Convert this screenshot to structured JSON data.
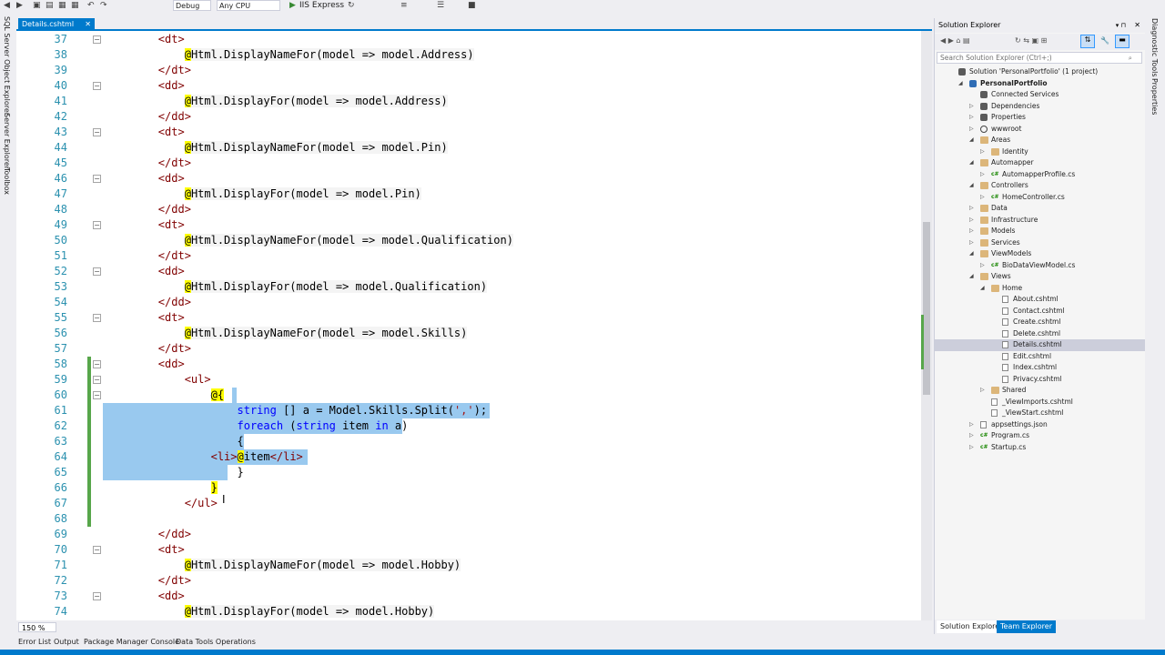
{
  "toolbar": {
    "config": "Debug",
    "platform": "Any CPU",
    "run_label": "IIS Express"
  },
  "left_tools": [
    "SQL Server Object Explorer",
    "Server Explorer",
    "Toolbox"
  ],
  "right_tools": [
    "Diagnostic Tools",
    "Properties"
  ],
  "tab": {
    "title": "Details.cshtml"
  },
  "editor": {
    "zoom": "150 %",
    "lines": [
      {
        "n": "37",
        "parts": [
          {
            "t": "        "
          },
          {
            "t": "<dt>",
            "c": "tag"
          }
        ]
      },
      {
        "n": "38",
        "parts": [
          {
            "t": "            "
          },
          {
            "t": "@",
            "c": "at"
          },
          {
            "t": "Html.DisplayNameFor(model => model.Address)",
            "c": "rz"
          }
        ]
      },
      {
        "n": "39",
        "parts": [
          {
            "t": "        "
          },
          {
            "t": "</dt>",
            "c": "tag"
          }
        ]
      },
      {
        "n": "40",
        "parts": [
          {
            "t": "        "
          },
          {
            "t": "<dd>",
            "c": "tag"
          }
        ]
      },
      {
        "n": "41",
        "parts": [
          {
            "t": "            "
          },
          {
            "t": "@",
            "c": "at"
          },
          {
            "t": "Html.DisplayFor(model => model.Address)",
            "c": "rz"
          }
        ]
      },
      {
        "n": "42",
        "parts": [
          {
            "t": "        "
          },
          {
            "t": "</dd>",
            "c": "tag"
          }
        ]
      },
      {
        "n": "43",
        "parts": [
          {
            "t": "        "
          },
          {
            "t": "<dt>",
            "c": "tag"
          }
        ]
      },
      {
        "n": "44",
        "parts": [
          {
            "t": "            "
          },
          {
            "t": "@",
            "c": "at"
          },
          {
            "t": "Html.DisplayNameFor(model => model.Pin)",
            "c": "rz"
          }
        ]
      },
      {
        "n": "45",
        "parts": [
          {
            "t": "        "
          },
          {
            "t": "</dt>",
            "c": "tag"
          }
        ]
      },
      {
        "n": "46",
        "parts": [
          {
            "t": "        "
          },
          {
            "t": "<dd>",
            "c": "tag"
          }
        ]
      },
      {
        "n": "47",
        "parts": [
          {
            "t": "            "
          },
          {
            "t": "@",
            "c": "at"
          },
          {
            "t": "Html.DisplayFor(model => model.Pin)",
            "c": "rz"
          }
        ]
      },
      {
        "n": "48",
        "parts": [
          {
            "t": "        "
          },
          {
            "t": "</dd>",
            "c": "tag"
          }
        ]
      },
      {
        "n": "49",
        "parts": [
          {
            "t": "        "
          },
          {
            "t": "<dt>",
            "c": "tag"
          }
        ]
      },
      {
        "n": "50",
        "parts": [
          {
            "t": "            "
          },
          {
            "t": "@",
            "c": "at"
          },
          {
            "t": "Html.DisplayNameFor(model => model.Qualification)",
            "c": "rz"
          }
        ]
      },
      {
        "n": "51",
        "parts": [
          {
            "t": "        "
          },
          {
            "t": "</dt>",
            "c": "tag"
          }
        ]
      },
      {
        "n": "52",
        "parts": [
          {
            "t": "        "
          },
          {
            "t": "<dd>",
            "c": "tag"
          }
        ]
      },
      {
        "n": "53",
        "parts": [
          {
            "t": "            "
          },
          {
            "t": "@",
            "c": "at"
          },
          {
            "t": "Html.DisplayFor(model => model.Qualification)",
            "c": "rz"
          }
        ]
      },
      {
        "n": "54",
        "parts": [
          {
            "t": "        "
          },
          {
            "t": "</dd>",
            "c": "tag"
          }
        ]
      },
      {
        "n": "55",
        "parts": [
          {
            "t": "        "
          },
          {
            "t": "<dt>",
            "c": "tag"
          }
        ]
      },
      {
        "n": "56",
        "parts": [
          {
            "t": "            "
          },
          {
            "t": "@",
            "c": "at"
          },
          {
            "t": "Html.DisplayNameFor(model => model.Skills)",
            "c": "rz"
          }
        ]
      },
      {
        "n": "57",
        "parts": [
          {
            "t": "        "
          },
          {
            "t": "</dt>",
            "c": "tag"
          }
        ]
      },
      {
        "n": "58",
        "parts": [
          {
            "t": "        "
          },
          {
            "t": "<dd>",
            "c": "tag"
          }
        ]
      },
      {
        "n": "59",
        "parts": [
          {
            "t": "            "
          },
          {
            "t": "<ul>",
            "c": "tag"
          }
        ]
      },
      {
        "n": "60",
        "parts": [
          {
            "t": "                "
          },
          {
            "t": "@{",
            "c": "at"
          }
        ]
      },
      {
        "n": "61",
        "parts": [
          {
            "t": "                    "
          },
          {
            "t": "string",
            "c": "blue"
          },
          {
            "t": " [] a = Model.Skills.Split("
          },
          {
            "t": "','",
            "c": "str"
          },
          {
            "t": ");"
          }
        ]
      },
      {
        "n": "62",
        "parts": [
          {
            "t": "                    "
          },
          {
            "t": "foreach",
            "c": "blue"
          },
          {
            "t": " ("
          },
          {
            "t": "string",
            "c": "blue"
          },
          {
            "t": " item "
          },
          {
            "t": "in",
            "c": "blue"
          },
          {
            "t": " a)"
          }
        ]
      },
      {
        "n": "63",
        "parts": [
          {
            "t": "                    {"
          }
        ]
      },
      {
        "n": "64",
        "parts": [
          {
            "t": "                "
          },
          {
            "t": "<li>",
            "c": "tag"
          },
          {
            "t": "@",
            "c": "at"
          },
          {
            "t": "item"
          },
          {
            "t": "</li>",
            "c": "tag"
          }
        ]
      },
      {
        "n": "65",
        "parts": [
          {
            "t": "                    }"
          }
        ]
      },
      {
        "n": "66",
        "parts": [
          {
            "t": "                "
          },
          {
            "t": "}",
            "c": "at"
          }
        ]
      },
      {
        "n": "67",
        "parts": [
          {
            "t": "            "
          },
          {
            "t": "</ul>",
            "c": "tag"
          }
        ]
      },
      {
        "n": "68",
        "parts": []
      },
      {
        "n": "69",
        "parts": [
          {
            "t": "        "
          },
          {
            "t": "</dd>",
            "c": "tag"
          }
        ]
      },
      {
        "n": "70",
        "parts": [
          {
            "t": "        "
          },
          {
            "t": "<dt>",
            "c": "tag"
          }
        ]
      },
      {
        "n": "71",
        "parts": [
          {
            "t": "            "
          },
          {
            "t": "@",
            "c": "at"
          },
          {
            "t": "Html.DisplayNameFor(model => model.Hobby)",
            "c": "rz"
          }
        ]
      },
      {
        "n": "72",
        "parts": [
          {
            "t": "        "
          },
          {
            "t": "</dt>",
            "c": "tag"
          }
        ]
      },
      {
        "n": "73",
        "parts": [
          {
            "t": "        "
          },
          {
            "t": "<dd>",
            "c": "tag"
          }
        ]
      },
      {
        "n": "74",
        "parts": [
          {
            "t": "            "
          },
          {
            "t": "@",
            "c": "at"
          },
          {
            "t": "Html.DisplayFor(model => model.Hobby)",
            "c": "rz"
          }
        ]
      }
    ]
  },
  "solution_explorer": {
    "title": "Solution Explorer",
    "search_placeholder": "Search Solution Explorer (Ctrl+;)",
    "items": [
      {
        "label": "Solution 'PersonalPortfolio' (1 project)",
        "depth": 0,
        "icon": "solution-icon",
        "arrow": ""
      },
      {
        "label": "PersonalPortfolio",
        "depth": 1,
        "icon": "web-project-icon",
        "arrow": "open",
        "bold": true
      },
      {
        "label": "Connected Services",
        "depth": 2,
        "icon": "connected-services-icon",
        "arrow": ""
      },
      {
        "label": "Dependencies",
        "depth": 2,
        "icon": "dependencies-icon",
        "arrow": "closed"
      },
      {
        "label": "Properties",
        "depth": 2,
        "icon": "wrench-icon",
        "arrow": "closed"
      },
      {
        "label": "wwwroot",
        "depth": 2,
        "icon": "globe-icon",
        "arrow": "closed"
      },
      {
        "label": "Areas",
        "depth": 2,
        "icon": "folder-icon",
        "arrow": "open"
      },
      {
        "label": "Identity",
        "depth": 3,
        "icon": "folder-icon",
        "arrow": "closed"
      },
      {
        "label": "Automapper",
        "depth": 2,
        "icon": "folder-icon",
        "arrow": "open"
      },
      {
        "label": "AutomapperProfile.cs",
        "depth": 3,
        "icon": "csharp-file-icon",
        "arrow": "closed"
      },
      {
        "label": "Controllers",
        "depth": 2,
        "icon": "folder-icon",
        "arrow": "open"
      },
      {
        "label": "HomeController.cs",
        "depth": 3,
        "icon": "csharp-file-icon",
        "arrow": "closed"
      },
      {
        "label": "Data",
        "depth": 2,
        "icon": "folder-icon",
        "arrow": "closed"
      },
      {
        "label": "Infrastructure",
        "depth": 2,
        "icon": "folder-icon",
        "arrow": "closed"
      },
      {
        "label": "Models",
        "depth": 2,
        "icon": "folder-icon",
        "arrow": "closed"
      },
      {
        "label": "Services",
        "depth": 2,
        "icon": "folder-icon",
        "arrow": "closed"
      },
      {
        "label": "ViewModels",
        "depth": 2,
        "icon": "folder-icon",
        "arrow": "open"
      },
      {
        "label": "BioDataViewModel.cs",
        "depth": 3,
        "icon": "csharp-file-icon",
        "arrow": "closed"
      },
      {
        "label": "Views",
        "depth": 2,
        "icon": "folder-icon",
        "arrow": "open"
      },
      {
        "label": "Home",
        "depth": 3,
        "icon": "folder-icon",
        "arrow": "open"
      },
      {
        "label": "About.cshtml",
        "depth": 4,
        "icon": "razor-file-icon",
        "arrow": ""
      },
      {
        "label": "Contact.cshtml",
        "depth": 4,
        "icon": "razor-file-icon",
        "arrow": ""
      },
      {
        "label": "Create.cshtml",
        "depth": 4,
        "icon": "razor-file-icon",
        "arrow": ""
      },
      {
        "label": "Delete.cshtml",
        "depth": 4,
        "icon": "razor-file-icon",
        "arrow": ""
      },
      {
        "label": "Details.cshtml",
        "depth": 4,
        "icon": "razor-file-icon",
        "arrow": "",
        "selected": true
      },
      {
        "label": "Edit.cshtml",
        "depth": 4,
        "icon": "razor-file-icon",
        "arrow": ""
      },
      {
        "label": "Index.cshtml",
        "depth": 4,
        "icon": "razor-file-icon",
        "arrow": ""
      },
      {
        "label": "Privacy.cshtml",
        "depth": 4,
        "icon": "razor-file-icon",
        "arrow": ""
      },
      {
        "label": "Shared",
        "depth": 3,
        "icon": "folder-icon",
        "arrow": "closed"
      },
      {
        "label": "_ViewImports.cshtml",
        "depth": 3,
        "icon": "razor-file-icon",
        "arrow": ""
      },
      {
        "label": "_ViewStart.cshtml",
        "depth": 3,
        "icon": "razor-file-icon",
        "arrow": ""
      },
      {
        "label": "appsettings.json",
        "depth": 2,
        "icon": "json-file-icon",
        "arrow": "closed"
      },
      {
        "label": "Program.cs",
        "depth": 2,
        "icon": "csharp-file-icon",
        "arrow": "closed"
      },
      {
        "label": "Startup.cs",
        "depth": 2,
        "icon": "csharp-file-icon",
        "arrow": "closed"
      }
    ],
    "tabs": [
      "Solution Explorer",
      "Team Explorer"
    ]
  },
  "bottom_tabs": [
    "Error List",
    "Output",
    "Package Manager Console",
    "Data Tools Operations"
  ],
  "colors": {
    "accent": "#007acc",
    "selection": "#99c9ef",
    "razor_at": "#ffff00",
    "line_numbers": "#2b91af"
  }
}
